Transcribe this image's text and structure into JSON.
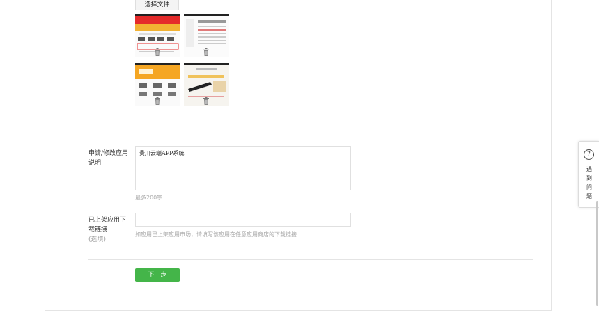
{
  "upload": {
    "choose_file_label": "选择文件",
    "thumbnails": [
      {
        "name": "screenshot-1",
        "theme": "red"
      },
      {
        "name": "screenshot-2",
        "theme": "white"
      },
      {
        "name": "screenshot-3",
        "theme": "orange"
      },
      {
        "name": "screenshot-4",
        "theme": "gray"
      }
    ],
    "delete_icon": "trash-icon"
  },
  "description": {
    "label": "申请/修改应用说明",
    "value": "贵川云端APP系统",
    "hint": "最多200字"
  },
  "download_link": {
    "label": "已上架应用下载链接",
    "optional": "(选填)",
    "value": "",
    "hint": "如应用已上架应用市场，请填写该应用在任意应用商店的下载链接"
  },
  "actions": {
    "next_label": "下一步",
    "accent": "#44b549"
  },
  "help": {
    "icon": "question-icon",
    "label": "遇到问题"
  }
}
